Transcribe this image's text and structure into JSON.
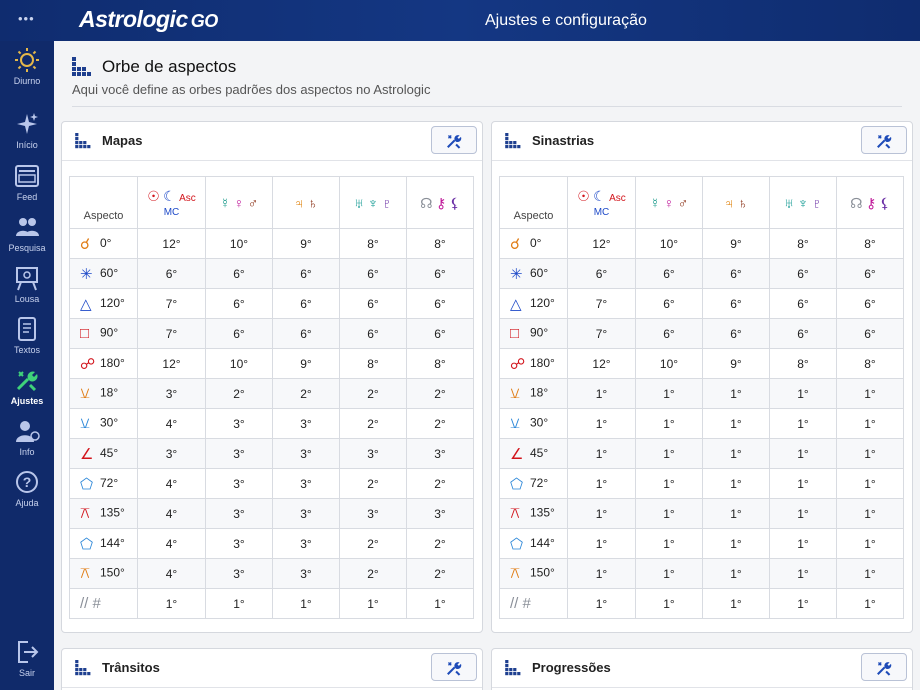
{
  "app": {
    "logo": "Astrologic",
    "logo_suffix": "GO",
    "dots": "•••",
    "title": "Ajustes e configuração"
  },
  "sidebar": {
    "items": [
      {
        "label": "Diurno",
        "icon": "sun-icon"
      },
      {
        "label": "Início",
        "icon": "sparkle-icon"
      },
      {
        "label": "Feed",
        "icon": "feed-icon"
      },
      {
        "label": "Pesquisa",
        "icon": "people-icon"
      },
      {
        "label": "Lousa",
        "icon": "easel-icon"
      },
      {
        "label": "Textos",
        "icon": "document-icon"
      },
      {
        "label": "Ajustes",
        "icon": "tools-icon",
        "active": true
      },
      {
        "label": "Info",
        "icon": "user-info-icon"
      },
      {
        "label": "Ajuda",
        "icon": "help-icon"
      },
      {
        "label": "Sair",
        "icon": "logout-icon"
      }
    ]
  },
  "header": {
    "title": "Orbe de aspectos",
    "subtitle": "Aqui você define as orbes padrões dos aspectos no Astrologic"
  },
  "columns": {
    "aspect": "Aspecto",
    "g1": {
      "sun": "☉",
      "moon": "☾",
      "asc": "Asc",
      "mc": "MC"
    },
    "g2": {
      "mercury": "☿",
      "venus": "♀",
      "mars": "♂"
    },
    "g3": {
      "jupiter": "♃",
      "saturn": "♄"
    },
    "g4": {
      "uranus": "♅",
      "neptune": "♆",
      "pluto": "♇"
    },
    "g5": {
      "node": "☊",
      "chiron": "⚷",
      "lilith": "⚸"
    }
  },
  "aspects": [
    {
      "glyph": "☌",
      "label": "0°",
      "color": "#e07b12"
    },
    {
      "glyph": "✳",
      "label": "60°",
      "color": "#1d49c8"
    },
    {
      "glyph": "△",
      "label": "120°",
      "color": "#1d49c8"
    },
    {
      "glyph": "□",
      "label": "90°",
      "color": "#d2151c"
    },
    {
      "glyph": "☍",
      "label": "180°",
      "color": "#d2151c"
    },
    {
      "glyph": "⚺",
      "label": "18°",
      "color": "#e07b12"
    },
    {
      "glyph": "⚺",
      "label": "30°",
      "color": "#2a86d8"
    },
    {
      "glyph": "∠",
      "label": "45°",
      "color": "#d2151c"
    },
    {
      "glyph": "⬠",
      "label": "72°",
      "color": "#2a86d8"
    },
    {
      "glyph": "⚻",
      "label": "135°",
      "color": "#d2151c"
    },
    {
      "glyph": "⬠",
      "label": "144°",
      "color": "#2a86d8"
    },
    {
      "glyph": "⚻",
      "label": "150°",
      "color": "#e07b12"
    },
    {
      "glyph": "// #",
      "label": "",
      "color": "#8a8f98"
    }
  ],
  "cards": [
    {
      "title": "Mapas",
      "rows": [
        [
          "12°",
          "10°",
          "9°",
          "8°",
          "8°"
        ],
        [
          "6°",
          "6°",
          "6°",
          "6°",
          "6°"
        ],
        [
          "7°",
          "6°",
          "6°",
          "6°",
          "6°"
        ],
        [
          "7°",
          "6°",
          "6°",
          "6°",
          "6°"
        ],
        [
          "12°",
          "10°",
          "9°",
          "8°",
          "8°"
        ],
        [
          "3°",
          "2°",
          "2°",
          "2°",
          "2°"
        ],
        [
          "4°",
          "3°",
          "3°",
          "2°",
          "2°"
        ],
        [
          "3°",
          "3°",
          "3°",
          "3°",
          "3°"
        ],
        [
          "4°",
          "3°",
          "3°",
          "2°",
          "2°"
        ],
        [
          "4°",
          "3°",
          "3°",
          "3°",
          "3°"
        ],
        [
          "4°",
          "3°",
          "3°",
          "2°",
          "2°"
        ],
        [
          "4°",
          "3°",
          "3°",
          "2°",
          "2°"
        ],
        [
          "1°",
          "1°",
          "1°",
          "1°",
          "1°"
        ]
      ]
    },
    {
      "title": "Sinastrias",
      "rows": [
        [
          "12°",
          "10°",
          "9°",
          "8°",
          "8°"
        ],
        [
          "6°",
          "6°",
          "6°",
          "6°",
          "6°"
        ],
        [
          "7°",
          "6°",
          "6°",
          "6°",
          "6°"
        ],
        [
          "7°",
          "6°",
          "6°",
          "6°",
          "6°"
        ],
        [
          "12°",
          "10°",
          "9°",
          "8°",
          "8°"
        ],
        [
          "1°",
          "1°",
          "1°",
          "1°",
          "1°"
        ],
        [
          "1°",
          "1°",
          "1°",
          "1°",
          "1°"
        ],
        [
          "1°",
          "1°",
          "1°",
          "1°",
          "1°"
        ],
        [
          "1°",
          "1°",
          "1°",
          "1°",
          "1°"
        ],
        [
          "1°",
          "1°",
          "1°",
          "1°",
          "1°"
        ],
        [
          "1°",
          "1°",
          "1°",
          "1°",
          "1°"
        ],
        [
          "1°",
          "1°",
          "1°",
          "1°",
          "1°"
        ],
        [
          "1°",
          "1°",
          "1°",
          "1°",
          "1°"
        ]
      ]
    },
    {
      "title": "Trânsitos"
    },
    {
      "title": "Progressões"
    }
  ]
}
